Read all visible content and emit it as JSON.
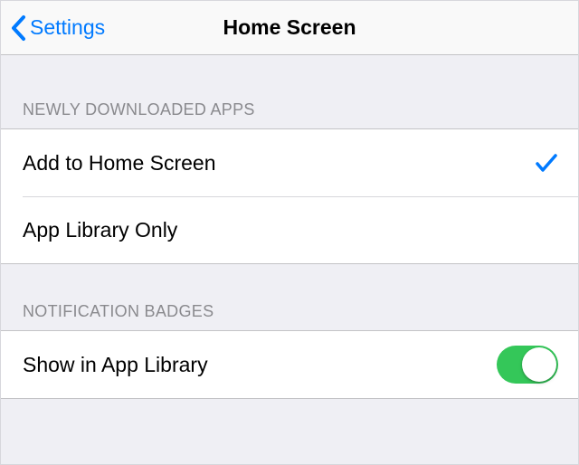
{
  "nav": {
    "back_label": "Settings",
    "title": "Home Screen"
  },
  "sections": {
    "newly_downloaded": {
      "header": "Newly Downloaded Apps",
      "options": [
        {
          "label": "Add to Home Screen",
          "selected": true
        },
        {
          "label": "App Library Only",
          "selected": false
        }
      ]
    },
    "notification_badges": {
      "header": "Notification Badges",
      "rows": [
        {
          "label": "Show in App Library",
          "toggled": true
        }
      ]
    }
  },
  "colors": {
    "accent": "#007aff",
    "switch_on": "#34c759",
    "background": "#efeff4"
  }
}
